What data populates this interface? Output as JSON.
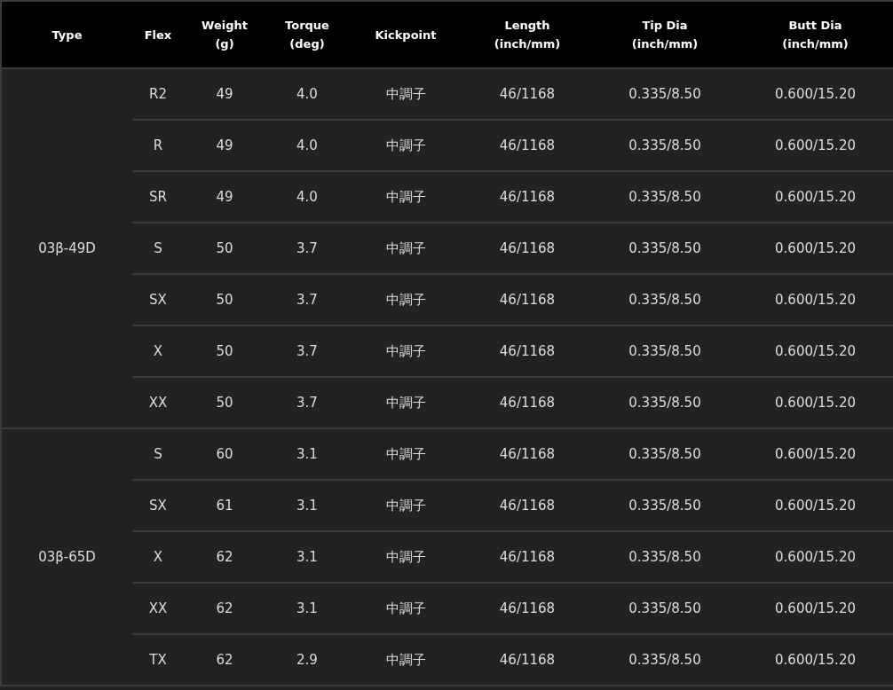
{
  "columns": [
    {
      "lines": [
        "Type"
      ]
    },
    {
      "lines": [
        "Flex"
      ]
    },
    {
      "lines": [
        "Weight",
        "(g)"
      ]
    },
    {
      "lines": [
        "Torque",
        "(deg)"
      ]
    },
    {
      "lines": [
        "Kickpoint"
      ]
    },
    {
      "lines": [
        "Length",
        "(inch/mm)"
      ]
    },
    {
      "lines": [
        "Tip Dia",
        "(inch/mm)"
      ]
    },
    {
      "lines": [
        "Butt Dia",
        "(inch/mm)"
      ]
    }
  ],
  "groups": [
    {
      "type": "03β-49D",
      "rows": [
        [
          "R2",
          "49",
          "4.0",
          "中調子",
          "46/1168",
          "0.335/8.50",
          "0.600/15.20"
        ],
        [
          "R",
          "49",
          "4.0",
          "中調子",
          "46/1168",
          "0.335/8.50",
          "0.600/15.20"
        ],
        [
          "SR",
          "49",
          "4.0",
          "中調子",
          "46/1168",
          "0.335/8.50",
          "0.600/15.20"
        ],
        [
          "S",
          "50",
          "3.7",
          "中調子",
          "46/1168",
          "0.335/8.50",
          "0.600/15.20"
        ],
        [
          "SX",
          "50",
          "3.7",
          "中調子",
          "46/1168",
          "0.335/8.50",
          "0.600/15.20"
        ],
        [
          "X",
          "50",
          "3.7",
          "中調子",
          "46/1168",
          "0.335/8.50",
          "0.600/15.20"
        ],
        [
          "XX",
          "50",
          "3.7",
          "中調子",
          "46/1168",
          "0.335/8.50",
          "0.600/15.20"
        ]
      ]
    },
    {
      "type": "03β-65D",
      "rows": [
        [
          "S",
          "60",
          "3.1",
          "中調子",
          "46/1168",
          "0.335/8.50",
          "0.600/15.20"
        ],
        [
          "SX",
          "61",
          "3.1",
          "中調子",
          "46/1168",
          "0.335/8.50",
          "0.600/15.20"
        ],
        [
          "X",
          "62",
          "3.1",
          "中調子",
          "46/1168",
          "0.335/8.50",
          "0.600/15.20"
        ],
        [
          "XX",
          "62",
          "3.1",
          "中調子",
          "46/1168",
          "0.335/8.50",
          "0.600/15.20"
        ],
        [
          "TX",
          "62",
          "2.9",
          "中調子",
          "46/1168",
          "0.335/8.50",
          "0.600/15.20"
        ]
      ]
    }
  ]
}
